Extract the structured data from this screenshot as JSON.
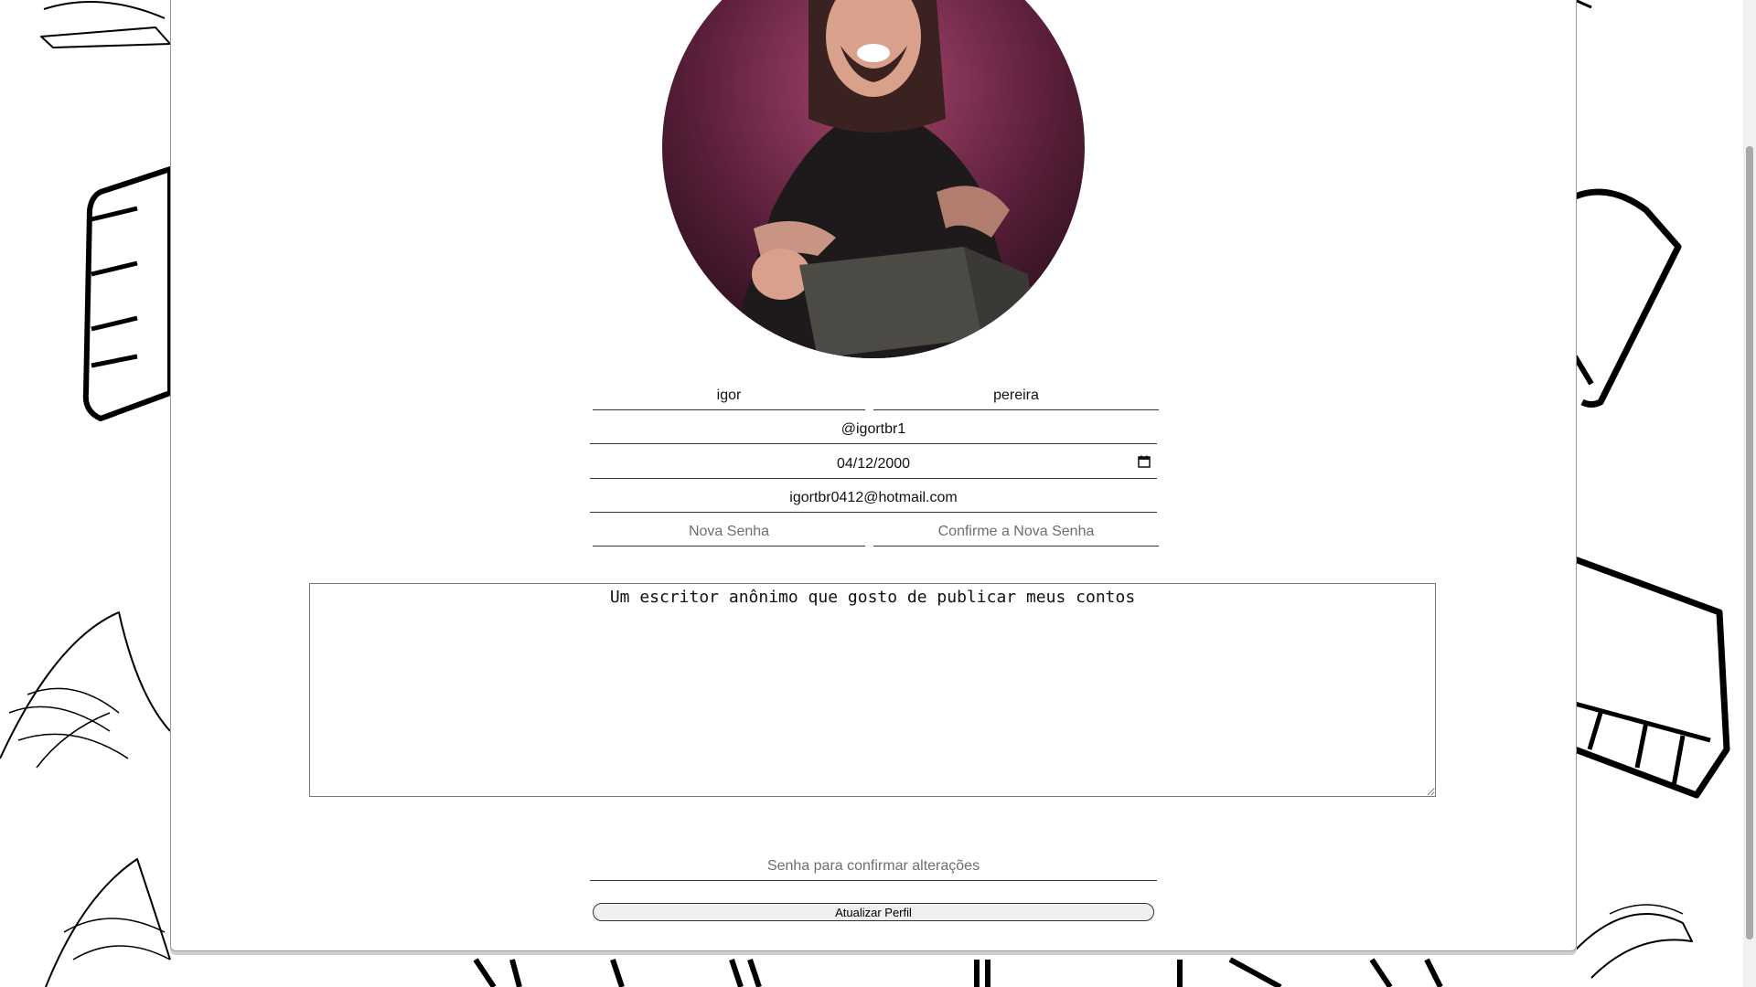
{
  "profile": {
    "first_name": "igor",
    "last_name": "pereira",
    "username": "@igortbr1",
    "birth_date": "04/12/2000",
    "email": "igortbr0412@hotmail.com",
    "new_password_placeholder": "Nova Senha",
    "confirm_password_placeholder": "Confirme a Nova Senha",
    "bio": "Um escritor anônimo que gosto de publicar meus contos",
    "confirm_changes_placeholder": "Senha para confirmar alterações",
    "submit_label": "Atualizar Perfil"
  },
  "icons": {
    "date": "calendar-icon",
    "avatar": "profile-photo"
  },
  "colors": {
    "background": "#ffffff",
    "line": "#333333",
    "placeholder": "#6e6e6e"
  }
}
